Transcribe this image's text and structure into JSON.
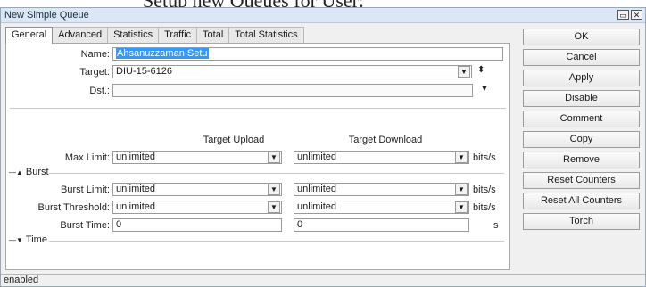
{
  "heading": "Setup new Queues for User:",
  "window": {
    "title": "New Simple Queue"
  },
  "tabs": [
    "General",
    "Advanced",
    "Statistics",
    "Traffic",
    "Total",
    "Total Statistics"
  ],
  "general": {
    "name_label": "Name:",
    "name_value": "Ahsanuzzaman Setu",
    "target_label": "Target:",
    "target_value": "DIU-15-6126",
    "dst_label": "Dst.:",
    "dst_value": "",
    "col_upload": "Target Upload",
    "col_download": "Target Download",
    "max_limit_label": "Max Limit:",
    "max_limit_upload": "unlimited",
    "max_limit_download": "unlimited",
    "burst_section": "Burst",
    "burst_limit_label": "Burst Limit:",
    "burst_limit_upload": "unlimited",
    "burst_limit_download": "unlimited",
    "burst_threshold_label": "Burst Threshold:",
    "burst_threshold_upload": "unlimited",
    "burst_threshold_download": "unlimited",
    "burst_time_label": "Burst Time:",
    "burst_time_upload": "0",
    "burst_time_download": "0",
    "time_section": "Time",
    "unit_bits": "bits/s",
    "unit_s": "s"
  },
  "buttons": [
    "OK",
    "Cancel",
    "Apply",
    "Disable",
    "Comment",
    "Copy",
    "Remove",
    "Reset Counters",
    "Reset All Counters",
    "Torch"
  ],
  "status": "enabled",
  "icons": {
    "dropdown": "dropdown-arrow-icon",
    "updown": "up-down-arrows-icon",
    "collapse": "triangle-up-icon",
    "expand": "triangle-down-icon"
  }
}
